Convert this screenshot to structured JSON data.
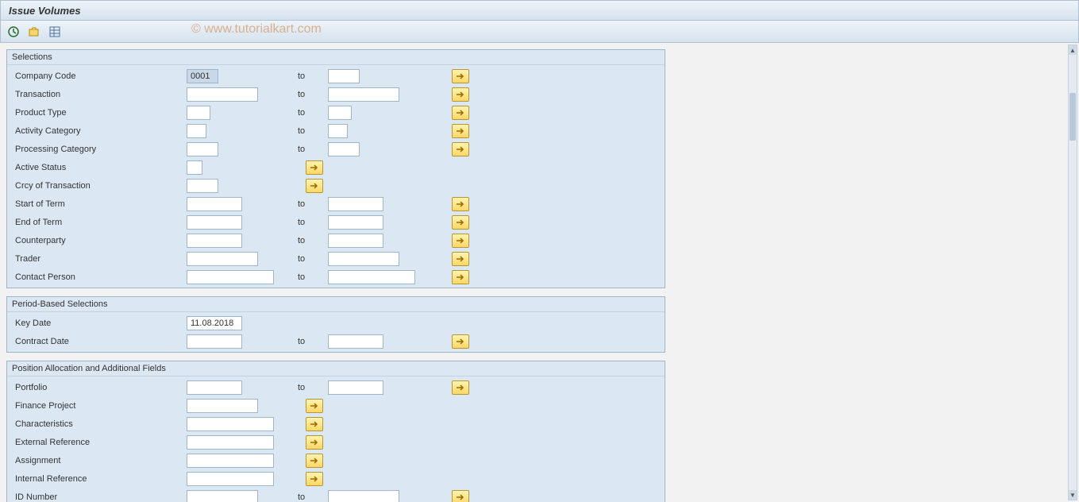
{
  "title": "Issue Volumes",
  "watermark": "© www.tutorialkart.com",
  "toolbar": {
    "execute_icon": "clock-check",
    "variant_icon": "folder-variant",
    "data_icon": "data-table"
  },
  "sections": {
    "selections": {
      "title": "Selections",
      "rows": [
        {
          "label": "Company Code",
          "from": "0001",
          "to": "",
          "from_w": "40",
          "to_w": "40",
          "multi": true,
          "hl": true
        },
        {
          "label": "Transaction",
          "from": "",
          "to": "",
          "from_w": "90",
          "to_w": "90",
          "multi": true
        },
        {
          "label": "Product Type",
          "from": "",
          "to": "",
          "from_w": "30",
          "to_w": "30",
          "multi": true
        },
        {
          "label": "Activity Category",
          "from": "",
          "to": "",
          "from_w": "25",
          "to_w": "25",
          "multi": true
        },
        {
          "label": "Processing Category",
          "from": "",
          "to": "",
          "from_w": "40",
          "to_w": "40",
          "multi": true
        },
        {
          "label": "Active Status",
          "from": "",
          "to": null,
          "from_w": "20",
          "to_w": null,
          "multi": true,
          "multi_near": true
        },
        {
          "label": "Crcy of Transaction",
          "from": "",
          "to": null,
          "from_w": "40",
          "to_w": null,
          "multi": true,
          "multi_near": true
        },
        {
          "label": "Start of Term",
          "from": "",
          "to": "",
          "from_w": "70",
          "to_w": "70",
          "multi": true
        },
        {
          "label": "End of Term",
          "from": "",
          "to": "",
          "from_w": "70",
          "to_w": "70",
          "multi": true
        },
        {
          "label": "Counterparty",
          "from": "",
          "to": "",
          "from_w": "70",
          "to_w": "70",
          "multi": true
        },
        {
          "label": "Trader",
          "from": "",
          "to": "",
          "from_w": "90",
          "to_w": "90",
          "multi": true
        },
        {
          "label": "Contact Person",
          "from": "",
          "to": "",
          "from_w": "110",
          "to_w": "110",
          "multi": true
        }
      ]
    },
    "period": {
      "title": "Period-Based Selections",
      "rows": [
        {
          "label": "Key Date",
          "from": "11.08.2018",
          "to": null,
          "from_w": "70",
          "to_w": null,
          "multi": false
        },
        {
          "label": "Contract Date",
          "from": "",
          "to": "",
          "from_w": "70",
          "to_w": "70",
          "multi": true
        }
      ]
    },
    "position": {
      "title": "Position Allocation and Additional Fields",
      "rows": [
        {
          "label": "Portfolio",
          "from": "",
          "to": "",
          "from_w": "70",
          "to_w": "70",
          "multi": true
        },
        {
          "label": "Finance Project",
          "from": "",
          "to": null,
          "from_w": "90",
          "to_w": null,
          "multi": true,
          "multi_near": true
        },
        {
          "label": "Characteristics",
          "from": "",
          "to": null,
          "from_w": "110",
          "to_w": null,
          "multi": true,
          "multi_near": true
        },
        {
          "label": "External Reference",
          "from": "",
          "to": null,
          "from_w": "110",
          "to_w": null,
          "multi": true,
          "multi_near": true
        },
        {
          "label": "Assignment",
          "from": "",
          "to": null,
          "from_w": "110",
          "to_w": null,
          "multi": true,
          "multi_near": true
        },
        {
          "label": "Internal Reference",
          "from": "",
          "to": null,
          "from_w": "110",
          "to_w": null,
          "multi": true,
          "multi_near": true
        },
        {
          "label": "ID Number",
          "from": "",
          "to": "",
          "from_w": "90",
          "to_w": "90",
          "multi": true
        }
      ]
    }
  },
  "labels": {
    "to": "to"
  }
}
